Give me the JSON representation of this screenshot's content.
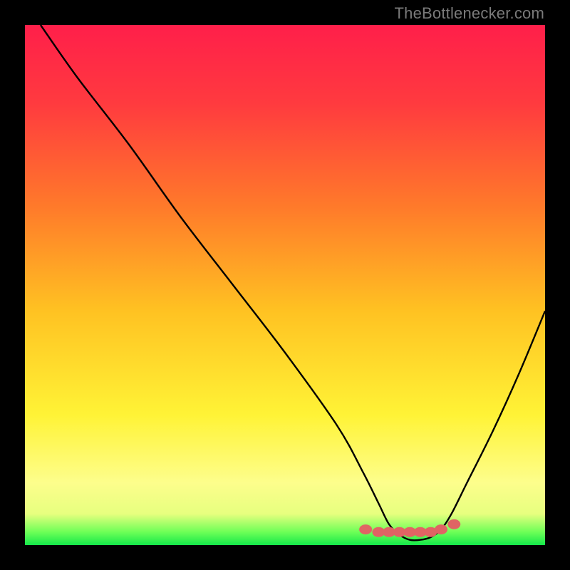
{
  "attribution": "TheBottlenecker.com",
  "chart_data": {
    "type": "line",
    "title": "",
    "xlabel": "",
    "ylabel": "",
    "xlim": [
      0,
      100
    ],
    "ylim": [
      0,
      100
    ],
    "x": [
      3,
      10,
      20,
      30,
      40,
      50,
      60,
      65,
      68,
      70,
      72,
      74,
      76,
      78,
      80,
      82,
      85,
      90,
      95,
      100
    ],
    "y": [
      100,
      90,
      77,
      63,
      50,
      37,
      23,
      14,
      8,
      4,
      2,
      1,
      1,
      1.5,
      3,
      6,
      12,
      22,
      33,
      45
    ],
    "marker_x": [
      65.5,
      68,
      70,
      72,
      74,
      76,
      78,
      80,
      82.5
    ],
    "marker_y": [
      3,
      2.5,
      2.5,
      2.5,
      2.5,
      2.5,
      2.5,
      3,
      4
    ],
    "gradient_stops": [
      {
        "offset": 0.0,
        "color": "#ff1f4a"
      },
      {
        "offset": 0.15,
        "color": "#ff3a3f"
      },
      {
        "offset": 0.35,
        "color": "#ff7a2a"
      },
      {
        "offset": 0.55,
        "color": "#ffc222"
      },
      {
        "offset": 0.75,
        "color": "#fff336"
      },
      {
        "offset": 0.88,
        "color": "#fdfe8c"
      },
      {
        "offset": 0.94,
        "color": "#e7ff7f"
      },
      {
        "offset": 0.975,
        "color": "#6dff57"
      },
      {
        "offset": 1.0,
        "color": "#15e84a"
      }
    ],
    "curve_color": "#000000",
    "marker_color": "#e06464"
  }
}
